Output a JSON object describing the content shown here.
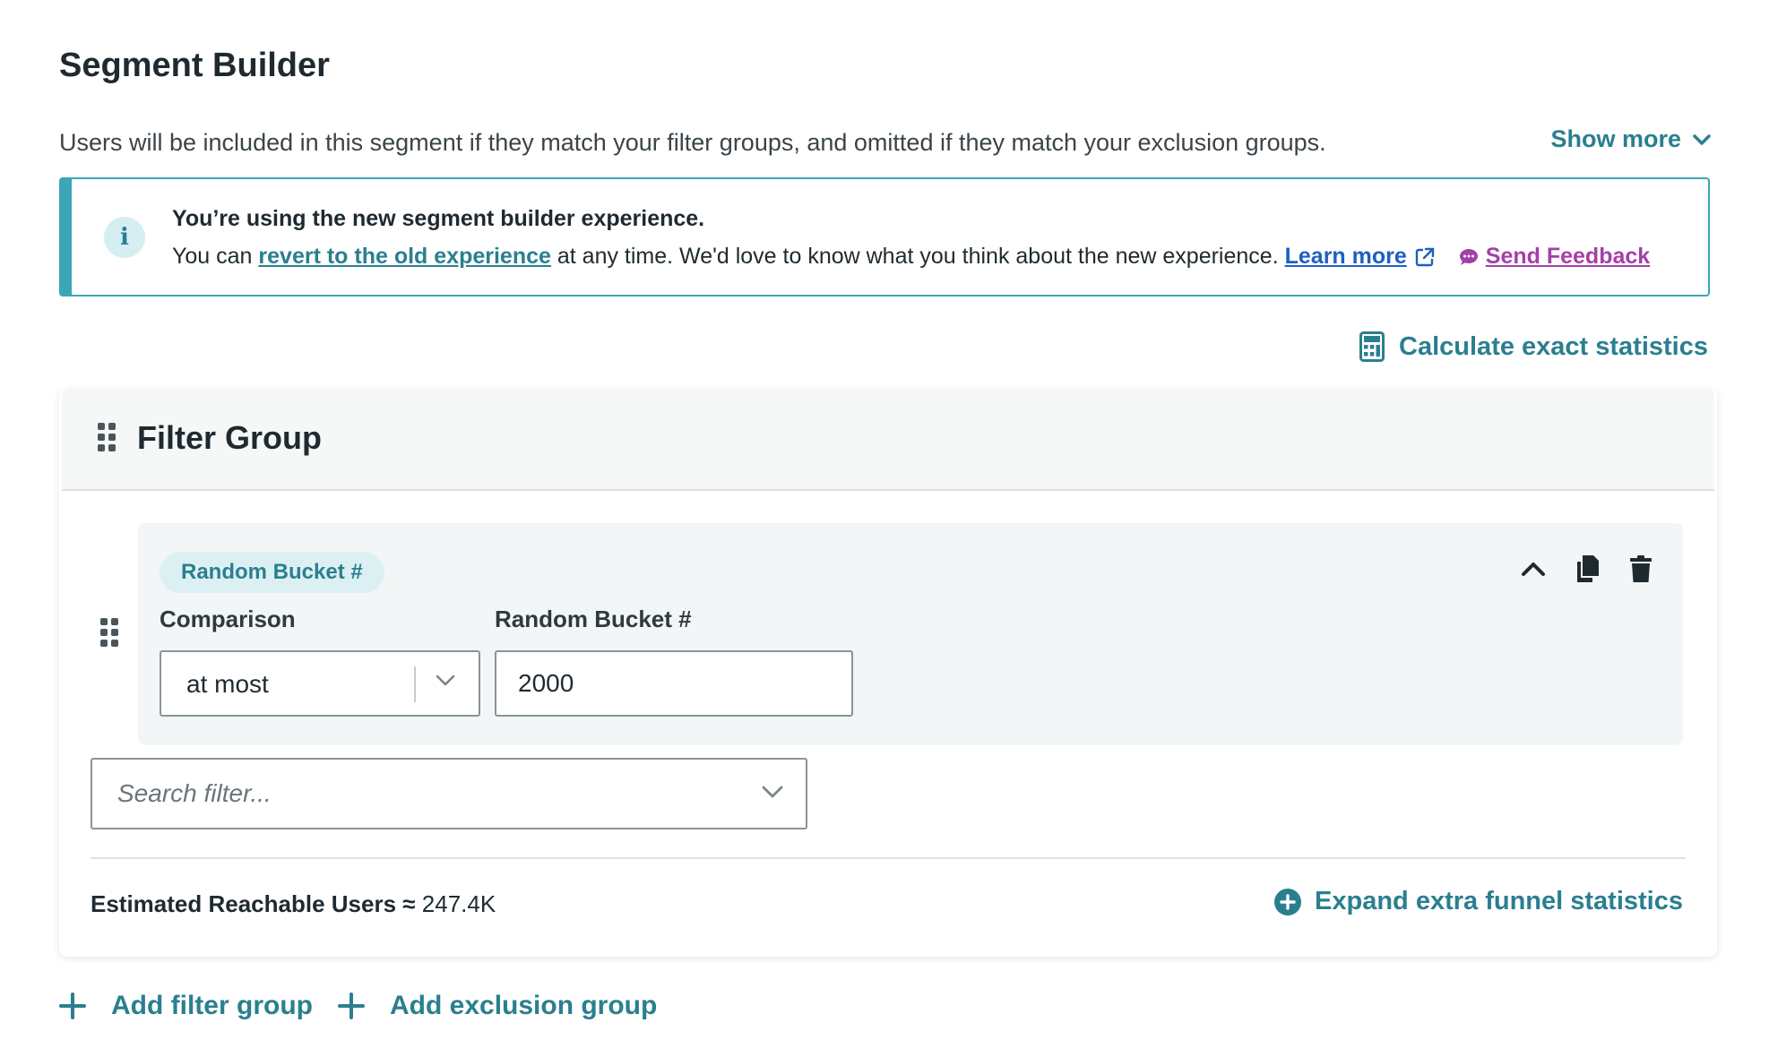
{
  "header": {
    "title": "Segment Builder",
    "description": "Users will be included in this segment if they match your filter groups, and omitted if they match your exclusion groups.",
    "show_more": "Show more"
  },
  "banner": {
    "title": "You’re using the new segment builder experience.",
    "prefix": "You can",
    "revert_link": "revert to the old experience",
    "middle": "at any time. We'd love to know what you think about the new experience.",
    "learn_more": "Learn more",
    "send_feedback": "Send Feedback"
  },
  "toolbar": {
    "calculate": "Calculate exact statistics"
  },
  "filter_group": {
    "title": "Filter Group",
    "condition": {
      "chip": "Random Bucket #",
      "comparison_label": "Comparison",
      "comparison_value": "at most",
      "value_label": "Random Bucket #",
      "value": "2000"
    },
    "search_placeholder": "Search filter...",
    "estimate_label": "Estimated Reachable Users ≈",
    "estimate_value": "247.4K",
    "expand_label": "Expand extra funnel statistics"
  },
  "footer": {
    "add_filter_group": "Add filter group",
    "add_exclusion_group": "Add exclusion group"
  },
  "colors": {
    "accent": "#2a7f8f",
    "banner_border": "#3aa6b6",
    "link_blue": "#1f5fc0",
    "feedback_purple": "#a53fa8"
  }
}
